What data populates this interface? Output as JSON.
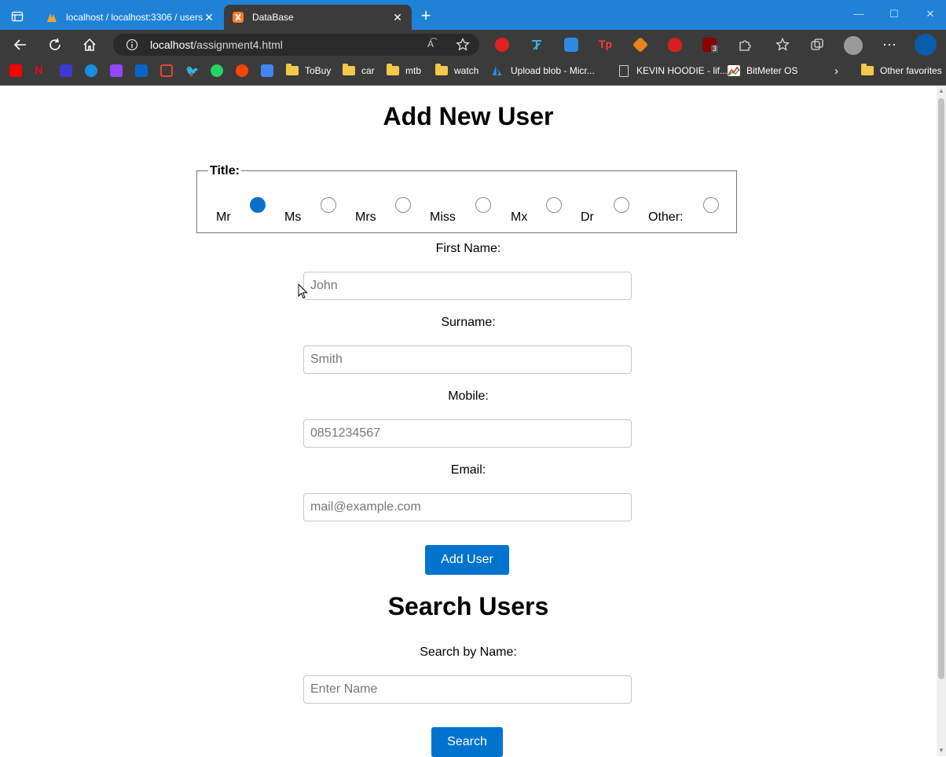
{
  "browser": {
    "tabs": [
      {
        "title": "localhost / localhost:3306 / users",
        "active": false
      },
      {
        "title": "DataBase",
        "active": true
      }
    ],
    "url_host": "localhost",
    "url_path": "/assignment4.html",
    "read_aloud_label": "A͡",
    "bookmarks": [
      {
        "label": "ToBuy",
        "type": "folder"
      },
      {
        "label": "car",
        "type": "folder"
      },
      {
        "label": "mtb",
        "type": "folder"
      },
      {
        "label": "watch",
        "type": "folder"
      },
      {
        "label": "Upload blob - Micr...",
        "type": "azure"
      },
      {
        "label": "KEVIN HOODIE - lif...",
        "type": "doc"
      },
      {
        "label": "BitMeter OS",
        "type": "bitmeter"
      }
    ],
    "other_favorites": "Other favorites",
    "extension_badge": "3"
  },
  "form": {
    "heading": "Add New User",
    "title_legend": "Title:",
    "title_options": [
      "Mr",
      "Ms",
      "Mrs",
      "Miss",
      "Mx",
      "Dr",
      "Other:"
    ],
    "selected_title": "Mr",
    "first_name_label": "First Name:",
    "first_name_placeholder": "John",
    "surname_label": "Surname:",
    "surname_placeholder": "Smith",
    "mobile_label": "Mobile:",
    "mobile_placeholder": "0851234567",
    "email_label": "Email:",
    "email_placeholder": "mail@example.com",
    "submit_label": "Add User"
  },
  "search": {
    "heading": "Search Users",
    "label": "Search by Name:",
    "placeholder": "Enter Name",
    "button_label": "Search"
  }
}
